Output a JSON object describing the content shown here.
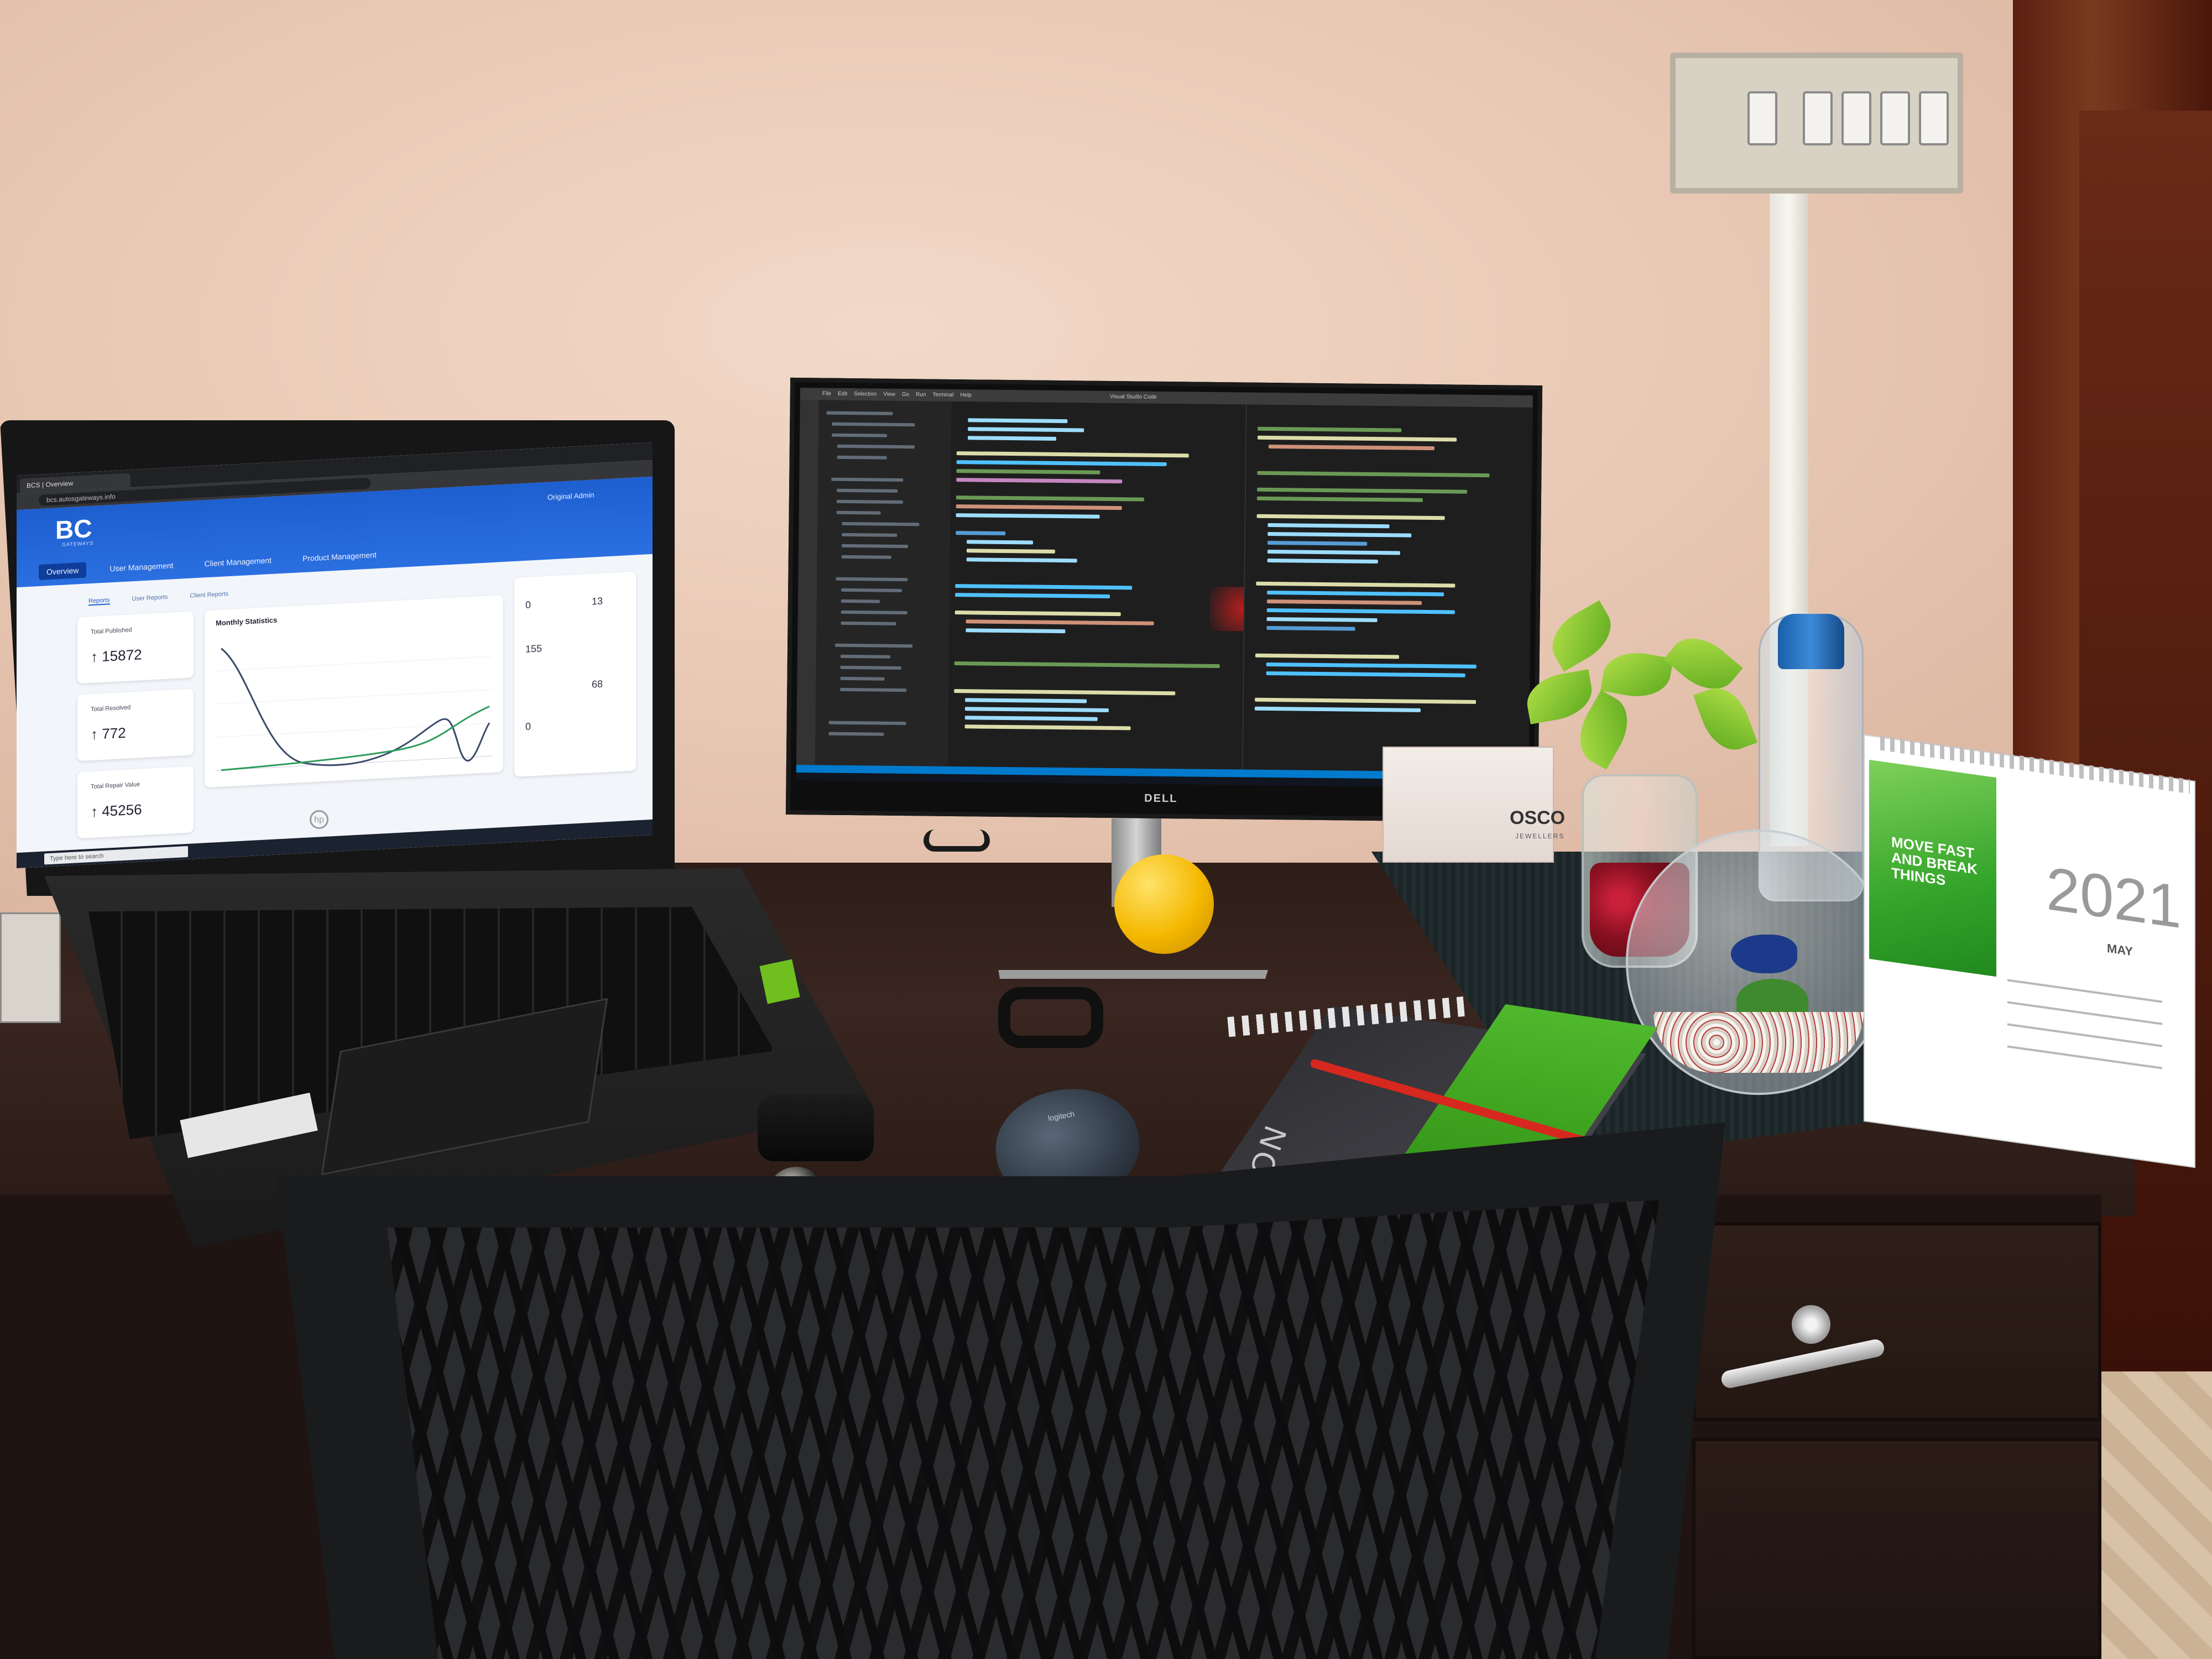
{
  "scene": "desk-setup",
  "laptop": {
    "brand_logo": "hp",
    "browser_tab": "BCS | Overview",
    "url": "bcs.autosgateways.info",
    "app": {
      "logo": "BC",
      "logo_sub": "GATEWAYS",
      "user": "Original Admin",
      "nav": [
        "Overview",
        "User Management",
        "Client Management",
        "Product Management"
      ],
      "sub_tabs": [
        "Reports",
        "User Reports",
        "Client Reports"
      ],
      "stats": [
        {
          "label": "Total Published",
          "value": "↑ 15872"
        },
        {
          "label": "Total Resolved",
          "value": "↑ 772"
        },
        {
          "label": "Total Repair Value",
          "value": "↑ 45256"
        }
      ],
      "chart_title": "Monthly Statistics",
      "side_numbers": [
        "0",
        "13",
        "155",
        "68",
        "0"
      ]
    },
    "taskbar_search": "Type here to search"
  },
  "monitor": {
    "brand_logo": "DELL",
    "window_title": "Visual Studio Code",
    "menu": [
      "File",
      "Edit",
      "Selection",
      "View",
      "Go",
      "Run",
      "Terminal",
      "Help"
    ]
  },
  "desk_items": {
    "mouse_label": "logitech",
    "notebook_text": "NOTEBOOK",
    "tissue_brand": "OSCO",
    "tissue_sub": "JEWELLERS"
  },
  "calendar": {
    "slogan": "MOVE FAST AND BREAK THINGS",
    "year": "2021",
    "month": "MAY"
  },
  "colors": {
    "wall": "#e9c9b6",
    "desk": "#2d1d18",
    "app_header": "#1e5fd0",
    "calendar_green": "#34a42a",
    "ball": "#f4b800"
  }
}
